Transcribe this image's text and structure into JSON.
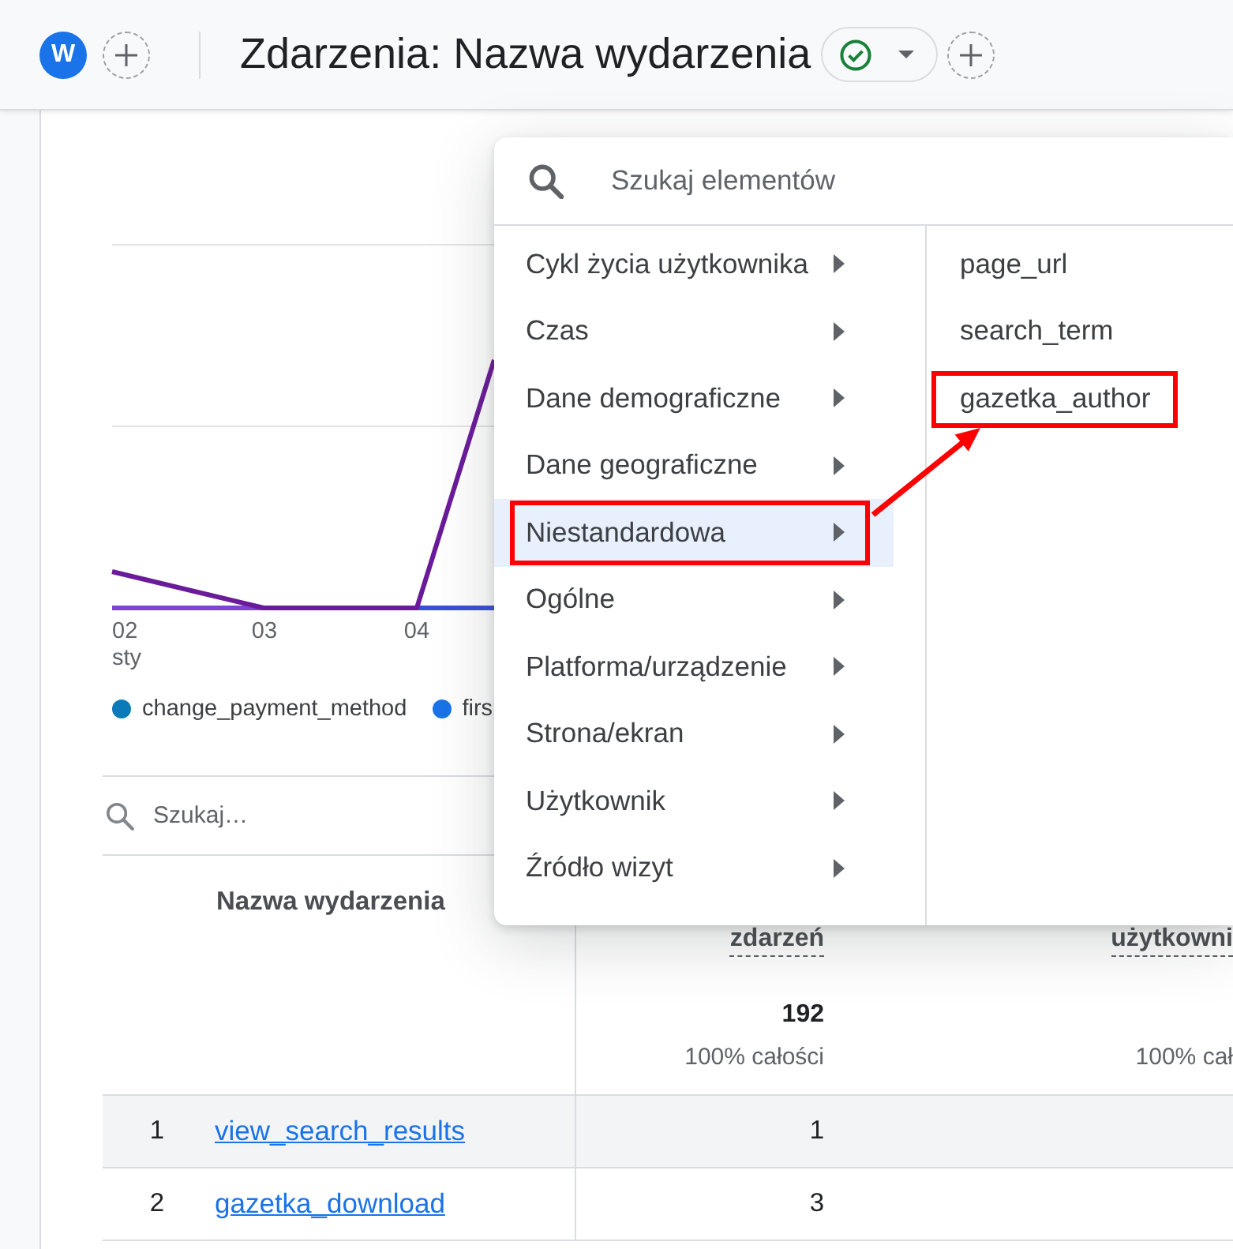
{
  "header": {
    "avatar": "W",
    "title": "Zdarzenia: Nazwa wydarzenia"
  },
  "chart": {
    "x_labels": [
      {
        "day": "02",
        "month": "sty"
      },
      {
        "day": "03"
      },
      {
        "day": "04"
      }
    ],
    "legend": [
      {
        "label": "change_payment_method",
        "color": "#0a7bb8"
      },
      {
        "label": "firs",
        "color": "#1a73e8"
      }
    ]
  },
  "table": {
    "search": {
      "placeholder": "Szukaj…"
    },
    "columns": [
      {
        "label": "Nazwa wydarzenia"
      },
      {
        "label": "zdarzeń",
        "total": "192",
        "share": "100% całości"
      },
      {
        "label": "użytkowni",
        "share": "100% cał"
      }
    ],
    "rows": [
      {
        "index": "1",
        "name": "view_search_results",
        "value": "1",
        "hovered": true
      },
      {
        "index": "2",
        "name": "gazetka_download",
        "value": "3",
        "hovered": false
      }
    ]
  },
  "menu": {
    "search": {
      "placeholder": "Szukaj elementów"
    },
    "categories": [
      {
        "label": "Cykl życia użytkownika",
        "selected": false,
        "annotated": false
      },
      {
        "label": "Czas",
        "selected": false,
        "annotated": false
      },
      {
        "label": "Dane demograficzne",
        "selected": false,
        "annotated": false
      },
      {
        "label": "Dane geograficzne",
        "selected": false,
        "annotated": false
      },
      {
        "label": "Niestandardowa",
        "selected": true,
        "annotated": true
      },
      {
        "label": "Ogólne",
        "selected": false,
        "annotated": false
      },
      {
        "label": "Platforma/urządzenie",
        "selected": false,
        "annotated": false
      },
      {
        "label": "Strona/ekran",
        "selected": false,
        "annotated": false
      },
      {
        "label": "Użytkownik",
        "selected": false,
        "annotated": false
      },
      {
        "label": "Źródło wizyt",
        "selected": false,
        "annotated": false
      }
    ],
    "options": [
      {
        "label": "page_url",
        "annotated": false
      },
      {
        "label": "search_term",
        "annotated": false
      },
      {
        "label": "gazetka_author",
        "annotated": true
      }
    ],
    "annotation_arrow": true
  }
}
